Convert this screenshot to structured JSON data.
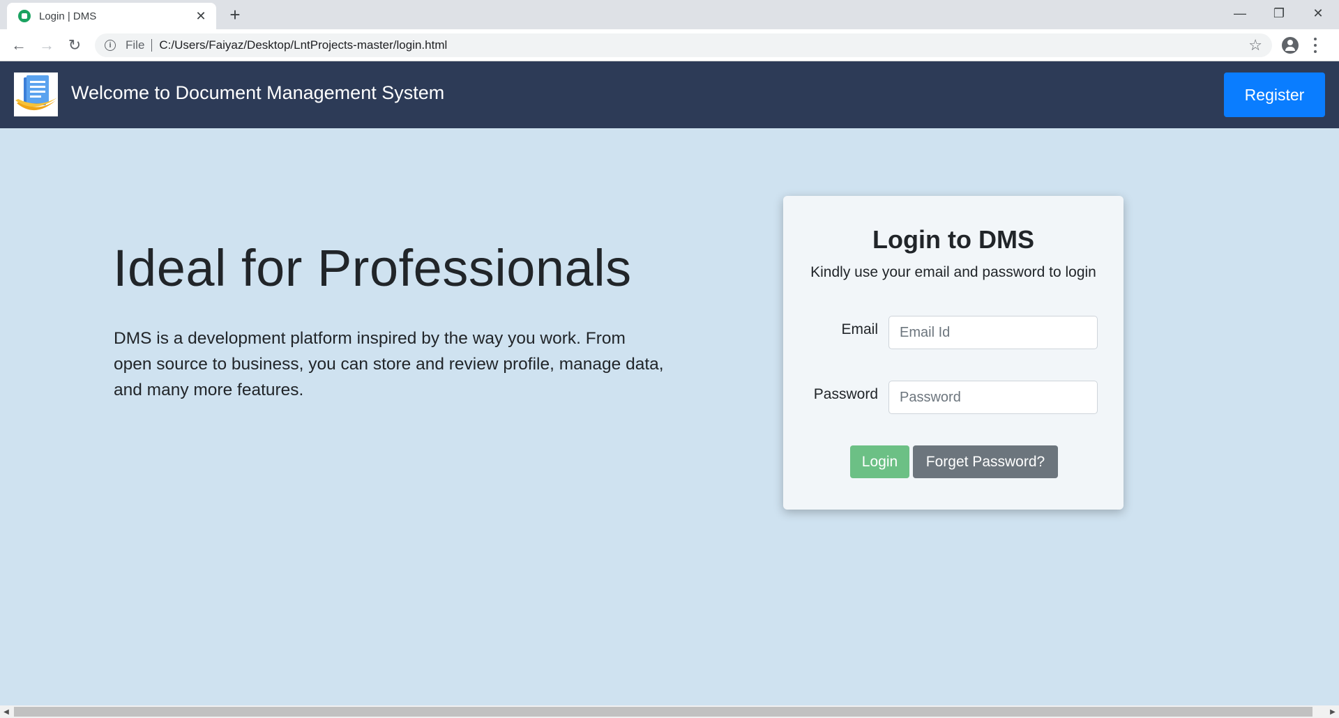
{
  "browser": {
    "tab_title": "Login | DMS",
    "tab_close": "✕",
    "new_tab": "+",
    "win_minimize": "—",
    "win_restore": "❐",
    "win_close": "✕",
    "back": "←",
    "forward": "→",
    "reload": "↻",
    "scheme_label": "File",
    "url": "C:/Users/Faiyaz/Desktop/LntProjects-master/login.html",
    "star": "☆"
  },
  "navbar": {
    "brand": "Welcome to Document Management System",
    "register_label": "Register"
  },
  "hero": {
    "title": "Ideal for Professionals",
    "description": "DMS is a development platform inspired by the way you work. From open source to business, you can store and review profile, manage data, and many more features."
  },
  "login_card": {
    "title": "Login to DMS",
    "subtitle": "Kindly use your email and password to login",
    "email_label": "Email",
    "email_placeholder": "Email Id",
    "password_label": "Password",
    "password_placeholder": "Password",
    "login_label": "Login",
    "forget_label": "Forget Password?"
  },
  "colors": {
    "navbar_bg": "#2d3b57",
    "page_bg": "#cfe2f0",
    "register_btn": "#0a7dff",
    "login_btn": "#6cc085",
    "forget_btn": "#6c757d"
  }
}
